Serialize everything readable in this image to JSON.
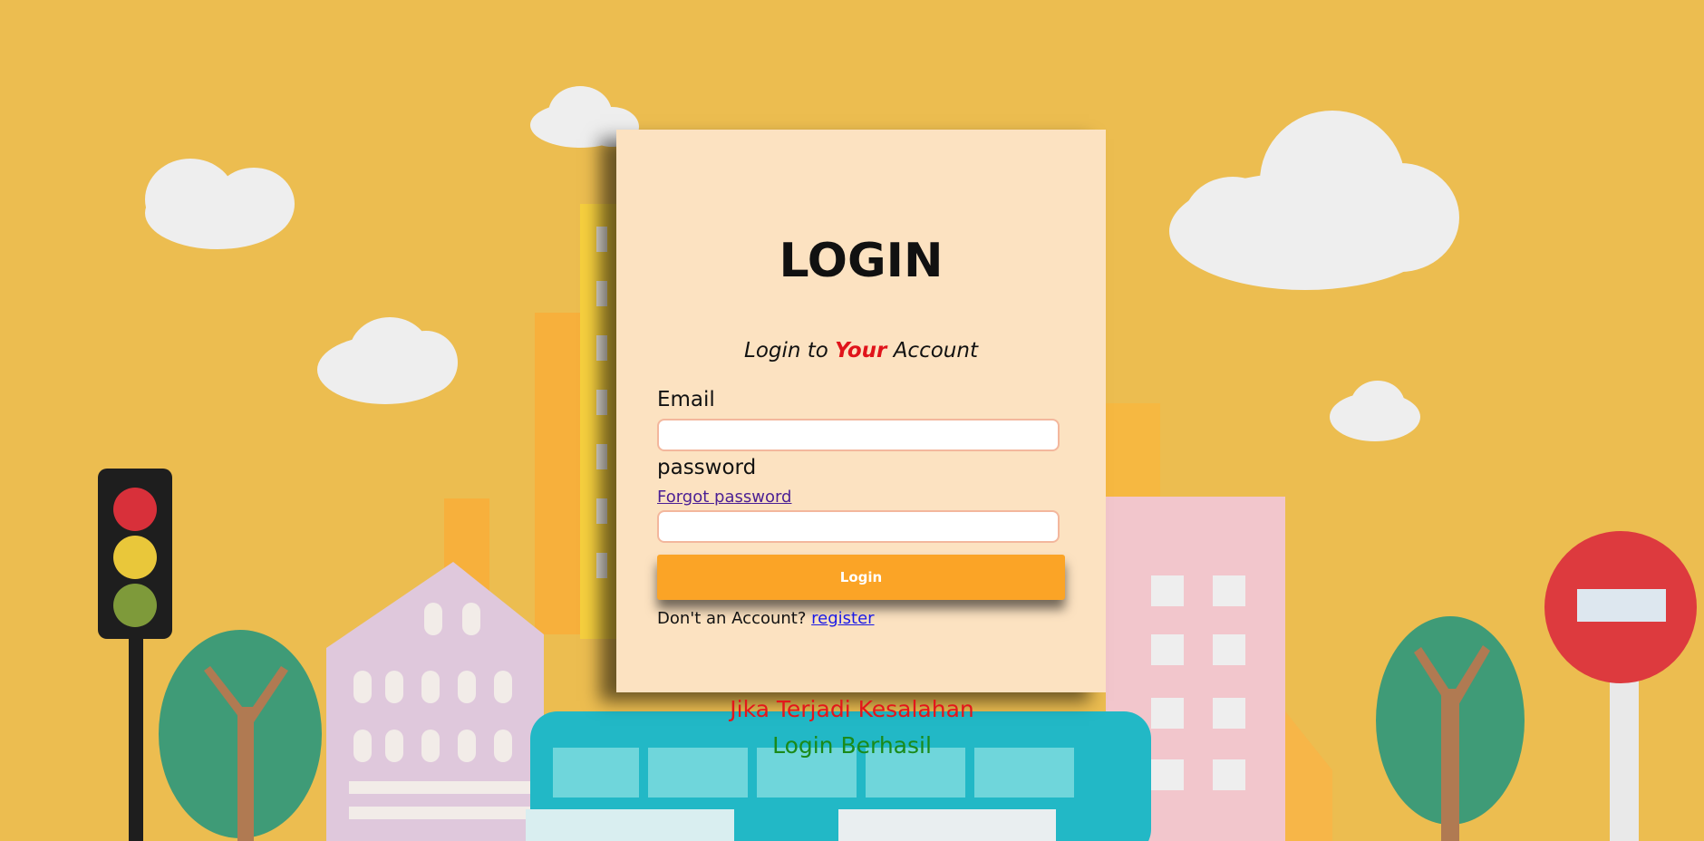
{
  "login": {
    "title": "LOGIN",
    "subtitle": {
      "prefix": "Login to ",
      "accent": "Your",
      "suffix": " Account"
    },
    "email_label": "Email",
    "email_value": "",
    "password_label": "password",
    "forgot_link": "Forgot password",
    "password_value": "",
    "submit_label": "Login",
    "register_prompt": "Don't an Account? ",
    "register_link": "register"
  },
  "messages": {
    "error": "Jika Terjadi Kesalahan",
    "success": "Login Berhasil"
  },
  "colors": {
    "background": "#ecbd50",
    "card": "#fce2c1",
    "button": "#fba426",
    "accent": "#e0141b",
    "error": "#e3161b",
    "success": "#1a8a1a"
  }
}
